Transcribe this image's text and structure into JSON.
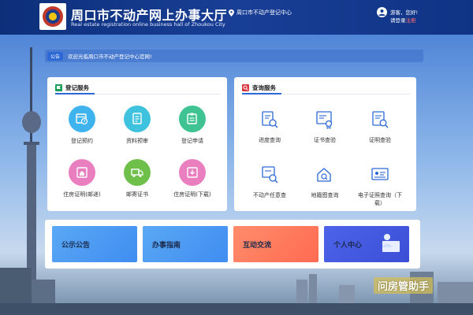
{
  "header": {
    "title": "周口市不动产网上办事大厅",
    "subtitle": "Real estate registration online business hall of Zhoukou City",
    "location": "周口市不动产登记中心",
    "greeting": "游客，您好!",
    "login": "请登录",
    "register": "注册"
  },
  "notice": {
    "tag": "公告",
    "text": "欢迎光临周口市不动产登记中心官网!"
  },
  "registration_services": {
    "title": "登记服务",
    "items": [
      {
        "label": "登记预约",
        "icon": "calendar-clock-icon",
        "color": "#3fb3ee"
      },
      {
        "label": "资料预审",
        "icon": "document-review-icon",
        "color": "#3fc2dd"
      },
      {
        "label": "登记申请",
        "icon": "application-form-icon",
        "color": "#40c392"
      },
      {
        "label": "住房证明(邮递)",
        "icon": "housing-certificate-icon",
        "color": "#ea7fbf"
      },
      {
        "label": "邮寄证书",
        "icon": "mail-truck-icon",
        "color": "#6fc04a"
      },
      {
        "label": "住房证明(下载)",
        "icon": "certificate-download-icon",
        "color": "#ea7fbf"
      }
    ]
  },
  "query_services": {
    "title": "查询服务",
    "items": [
      {
        "label": "进度查询",
        "icon": "progress-search-icon"
      },
      {
        "label": "证书查验",
        "icon": "certificate-verify-icon"
      },
      {
        "label": "证明查验",
        "icon": "proof-verify-icon"
      },
      {
        "label": "不动产任意查",
        "icon": "property-search-icon"
      },
      {
        "label": "地籍图查询",
        "icon": "cadastral-map-icon"
      },
      {
        "label": "电子证照查询（下载）",
        "icon": "e-license-icon"
      }
    ]
  },
  "bottom_buttons": {
    "public": "公示公告",
    "guide": "办事指南",
    "interact": "互动交流",
    "personal": "个人中心"
  },
  "watermark": "问房管助手",
  "colors": {
    "header": "#183f96",
    "accent": "#2d69d6",
    "register_red": "#ff6b6b"
  }
}
